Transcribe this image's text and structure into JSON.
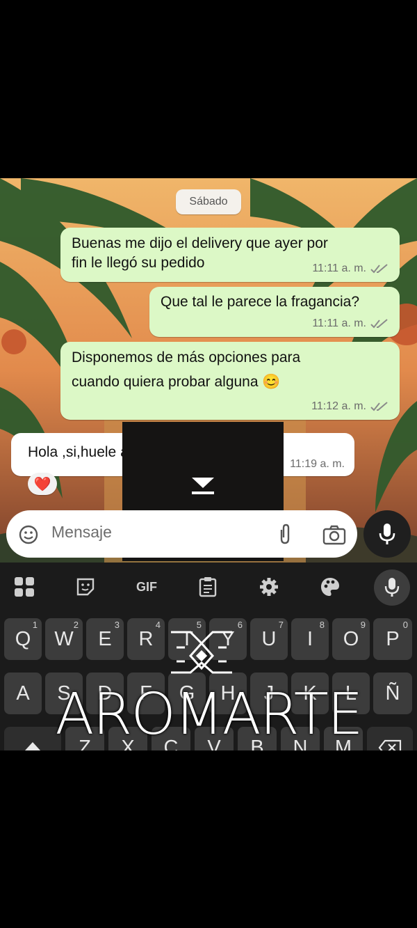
{
  "chat": {
    "date_chip": "Sábado",
    "messages": [
      {
        "direction": "out",
        "lines": [
          "Buenas me dijo el delivery que ayer por",
          "fin le llegó su pedido"
        ],
        "time": "11:11 a. m.",
        "status": "read"
      },
      {
        "direction": "out",
        "lines": [
          "Que tal le parece la fragancia?"
        ],
        "time": "11:11 a. m.",
        "status": "read"
      },
      {
        "direction": "out",
        "lines": [
          "Disponemos de más opciones para",
          "cuando quiera probar alguna 😊"
        ],
        "time": "11:12 a. m.",
        "status": "read"
      },
      {
        "direction": "in",
        "lines": [
          "Hola ,si,huele agradable, 💪😌"
        ],
        "time": "11:19 a. m.",
        "reaction": "❤️"
      }
    ]
  },
  "input": {
    "placeholder": "Mensaje"
  },
  "keyboard": {
    "toolbar": [
      "apps-icon",
      "sticker-icon",
      "GIF",
      "clipboard-icon",
      "settings-icon",
      "theme-palette-icon",
      "mic-icon"
    ],
    "row1": [
      {
        "key": "Q",
        "hint": "1"
      },
      {
        "key": "W",
        "hint": "2"
      },
      {
        "key": "E",
        "hint": "3"
      },
      {
        "key": "R",
        "hint": "4"
      },
      {
        "key": "T",
        "hint": "5"
      },
      {
        "key": "Y",
        "hint": "6"
      },
      {
        "key": "U",
        "hint": "7"
      },
      {
        "key": "I",
        "hint": "8"
      },
      {
        "key": "O",
        "hint": "9"
      },
      {
        "key": "P",
        "hint": "0"
      }
    ],
    "row2": [
      "A",
      "S",
      "D",
      "F",
      "G",
      "H",
      "J",
      "K",
      "L",
      "Ñ"
    ],
    "row3": [
      "Z",
      "X",
      "C",
      "V",
      "B",
      "N",
      "M"
    ]
  },
  "watermark": {
    "text": "AROMARTE"
  },
  "colors": {
    "outgoing_bubble": "#dcf8c6",
    "incoming_bubble": "#ffffff",
    "read_ticks": "#8a8a8a",
    "keyboard_bg": "#1b1b1b",
    "key_bg": "#3c3c3c"
  }
}
